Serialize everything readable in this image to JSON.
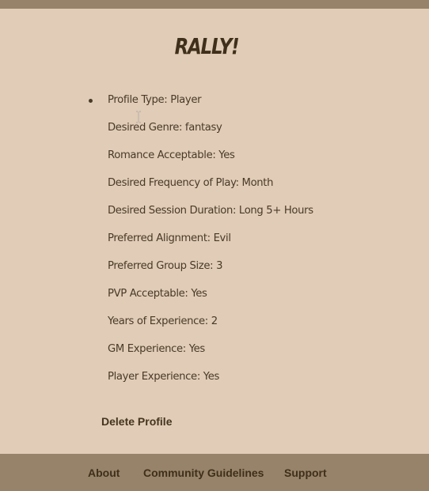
{
  "header": {
    "logo": "RALLY!"
  },
  "profile": {
    "items": [
      {
        "label": "Profile Type: Player"
      },
      {
        "label": "Desired Genre: fantasy"
      },
      {
        "label": "Romance Acceptable: Yes"
      },
      {
        "label": "Desired Frequency of Play: Month"
      },
      {
        "label": "Desired Session Duration: Long 5+ Hours"
      },
      {
        "label": "Preferred Alignment: Evil"
      },
      {
        "label": "Preferred Group Size: 3"
      },
      {
        "label": "PVP Acceptable: Yes"
      },
      {
        "label": "Years of Experience: 2"
      },
      {
        "label": "GM Experience: Yes"
      },
      {
        "label": "Player Experience: Yes"
      }
    ],
    "delete_label": "Delete Profile"
  },
  "footer": {
    "about": "About",
    "guidelines": "Community Guidelines",
    "support": "Support"
  },
  "colors": {
    "background": "#e0ccb7",
    "bar": "#978369",
    "text": "#45341f"
  },
  "icons": {
    "cursor": "text-cursor-icon"
  }
}
